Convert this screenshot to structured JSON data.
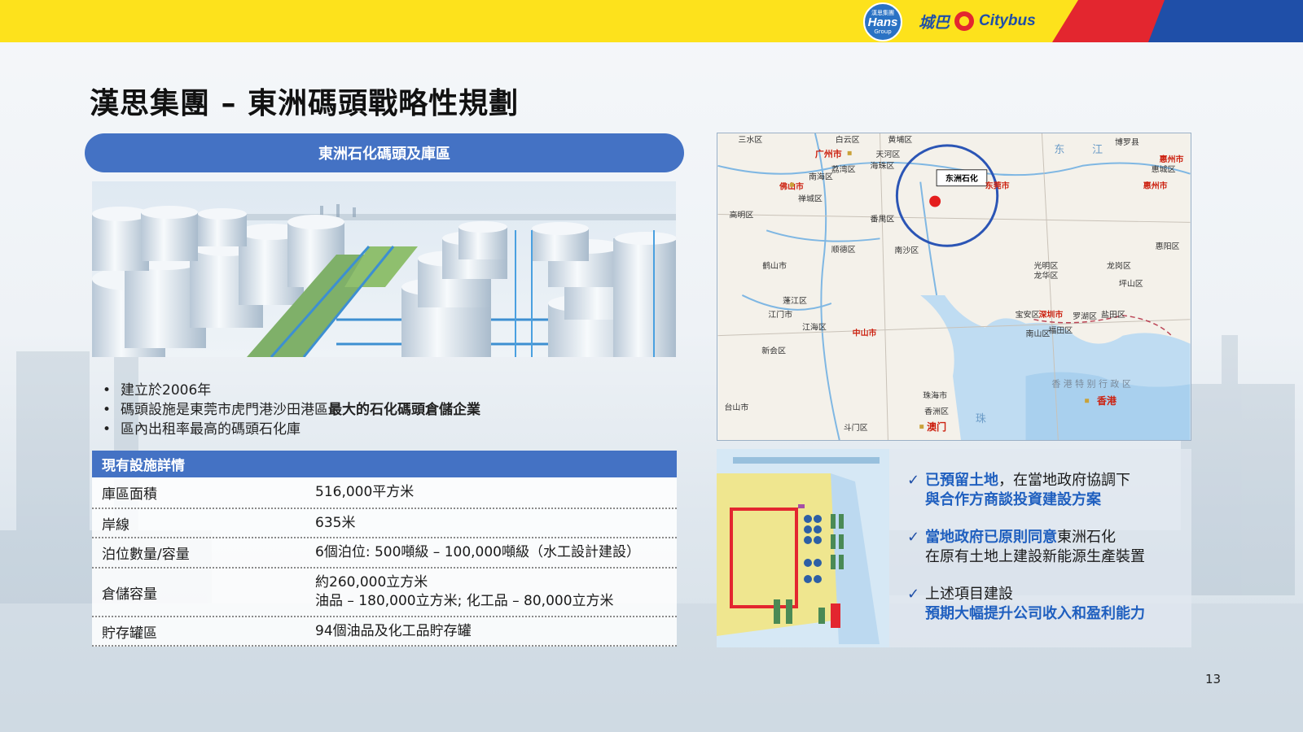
{
  "header": {
    "hans_logo": {
      "line1": "漢思集團",
      "main": "Hans",
      "line2": "Group"
    },
    "citybus_zh": "城巴",
    "citybus_en": "Citybus",
    "colors": {
      "yellow": "#fde21c",
      "red": "#e3262f",
      "blue": "#1f4fa8"
    }
  },
  "title": "漢思集團 – 東洲碼頭戰略性規劃",
  "pill_label": "東洲石化碼頭及庫區",
  "bullets": {
    "b1": "建立於2006年",
    "b2_plain": "碼頭設施是東莞市虎門港沙田港區",
    "b2_bold": "最大的石化碼頭倉儲企業",
    "b3": "區內出租率最高的碼頭石化庫"
  },
  "table": {
    "header": "現有設施詳情",
    "rows": [
      {
        "label": "庫區面積",
        "value": "516,000平方米"
      },
      {
        "label": "岸線",
        "value": "635米"
      },
      {
        "label": "泊位數量/容量",
        "value": "6個泊位: 500噸級 – 100,000噸級（水工設計建設）"
      },
      {
        "label": "倉儲容量",
        "value": "約260,000立方米",
        "value2": "油品 – 180,000立方米; 化工品 – 80,000立方米"
      },
      {
        "label": "貯存罐區",
        "value": "94個油品及化工品貯存罐"
      }
    ]
  },
  "map": {
    "labels": {
      "sanshui": "三水区",
      "baiyun": "白云区",
      "huangpu": "黄埔区",
      "boluo": "博罗县",
      "huizhou": "惠州市",
      "huicheng": "惠城区",
      "huizhou2": "惠州市",
      "guangzhou": "广州市",
      "tianhe": "天河区",
      "liwan": "荔湾区",
      "haizhu": "海珠区",
      "foshan": "佛山市",
      "nanhai": "南海区",
      "chancheng": "禅城区",
      "dongguan": "东莞市",
      "dongzhou": "东洲石化",
      "gaoming": "高明区",
      "panyu": "番禺区",
      "shunde": "顺德区",
      "nansha": "南沙区",
      "heshan": "鹤山市",
      "huiyang": "惠阳区",
      "guangming": "光明区",
      "longhua": "龙华区",
      "longgang": "龙岗区",
      "pingshan": "坪山区",
      "pengjiang": "蓬江区",
      "jiangmen": "江门市",
      "jianghai": "江海区",
      "zhongshan": "中山市",
      "baoan": "宝安区",
      "shenzhen": "深圳市",
      "luohu": "罗湖区",
      "yantian": "盐田区",
      "futian": "福田区",
      "nanshan": "南山区",
      "xinhui": "新会区",
      "taishan": "台山市",
      "zhuhai": "珠海市",
      "xiangzhou": "香洲区",
      "macao": "澳门",
      "hongkong": "香港",
      "doumen": "斗门区",
      "dong": "东",
      "jiang": "江",
      "zhu": "珠",
      "river_hk": "香 港 特 别 行 政 区"
    }
  },
  "points": [
    {
      "l1_blue": "已預留土地",
      "l1_plain": "，在當地政府協調下",
      "l2_blue": "與合作方商談投資建設方案"
    },
    {
      "l1_blue": "當地政府已原則同意",
      "l1_plain": "東洲石化",
      "l2_plain": "在原有土地上建設新能源生產裝置"
    },
    {
      "l1_plain": "上述項目建設",
      "l2_blue": "預期大幅提升公司收入和盈利能力"
    }
  ],
  "check_icon": "✓",
  "page_number": "13"
}
